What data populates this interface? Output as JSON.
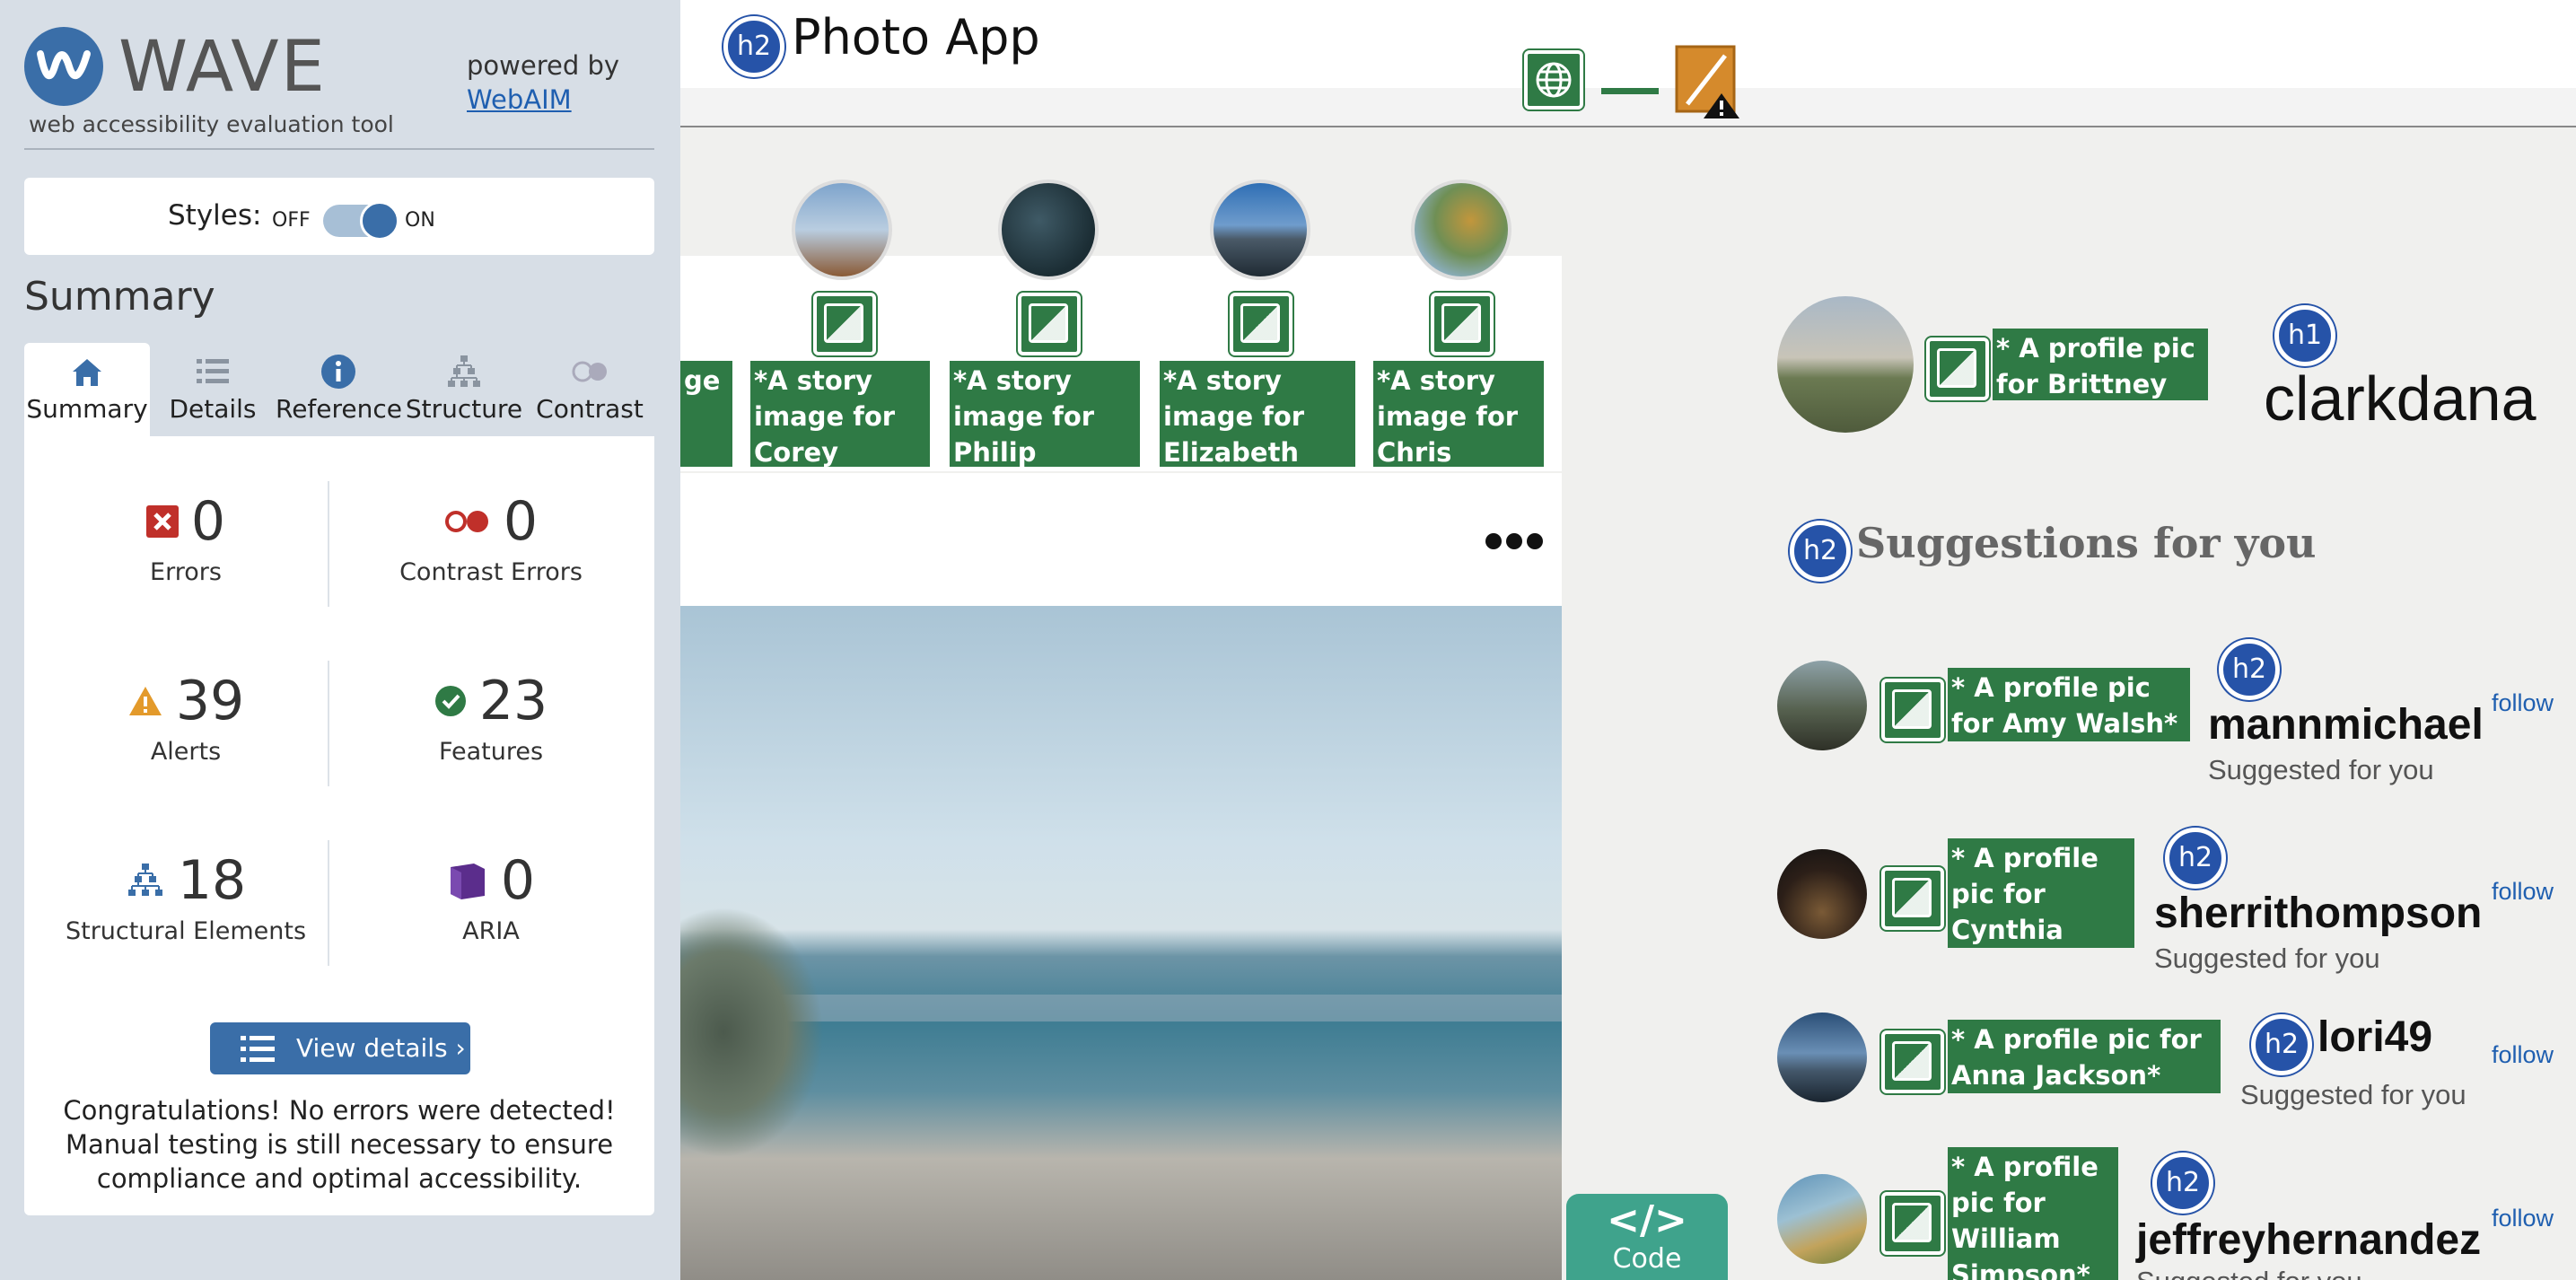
{
  "wave": {
    "logo_text": "WAVE",
    "logo_subtitle": "web accessibility evaluation tool",
    "powered_by": "powered by",
    "webaim_link": "WebAIM",
    "styles_label": "Styles:",
    "toggle_off": "OFF",
    "toggle_on": "ON",
    "summary_heading": "Summary",
    "tabs": [
      {
        "label": "Summary",
        "icon": "home-icon"
      },
      {
        "label": "Details",
        "icon": "list-icon"
      },
      {
        "label": "Reference",
        "icon": "info-icon"
      },
      {
        "label": "Structure",
        "icon": "hierarchy-icon"
      },
      {
        "label": "Contrast",
        "icon": "contrast-toggle-icon"
      }
    ],
    "stats": {
      "errors": {
        "count": "0",
        "label": "Errors"
      },
      "contrast_errors": {
        "count": "0",
        "label": "Contrast Errors"
      },
      "alerts": {
        "count": "39",
        "label": "Alerts"
      },
      "features": {
        "count": "23",
        "label": "Features"
      },
      "structural": {
        "count": "18",
        "label": "Structural Elements"
      },
      "aria": {
        "count": "0",
        "label": "ARIA"
      }
    },
    "view_details": "View details ›",
    "congrats": "Congratulations! No errors were detected! Manual testing is still necessary to ensure compliance and optimal accessibility."
  },
  "page": {
    "h2": "h2",
    "h1": "h1",
    "app_title": "Photo App",
    "stories": [
      {
        "alt": "ge"
      },
      {
        "alt": "*A story image for Corey Smith*"
      },
      {
        "alt": "*A story image for Philip Stewart*"
      },
      {
        "alt": "*A story image for Elizabeth Ward*"
      },
      {
        "alt": "*A story image for Chris Rose*"
      }
    ],
    "profile": {
      "alt": "* A profile pic for Brittney Brown*",
      "username": "clarkdana"
    },
    "suggestions_heading": "Suggestions for you",
    "suggestions": [
      {
        "alt": "* A profile pic for Amy Walsh*",
        "username": "mannmichael",
        "sub": "Suggested for you",
        "follow": "follow"
      },
      {
        "alt": "* A profile pic for Cynthia Richardson*",
        "username": "sherrithompson",
        "sub": "Suggested for you",
        "follow": "follow"
      },
      {
        "alt": "* A profile pic for Anna Jackson*",
        "username": "lori49",
        "sub": "Suggested for you",
        "follow": "follow"
      },
      {
        "alt": "* A profile pic for William Simpson*",
        "username": "jeffreyhernandez",
        "sub": "Suggested for you",
        "follow": "follow"
      }
    ],
    "code_button": "Code",
    "code_symbol": "</>"
  },
  "colors": {
    "wave_blue": "#3a6ea8",
    "alt_green": "#2f7a45",
    "h_badge": "#2653a8",
    "code_teal": "#3fa38c"
  }
}
